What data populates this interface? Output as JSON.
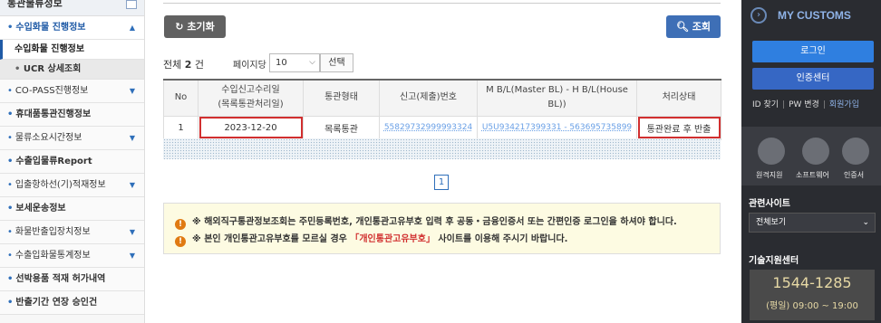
{
  "sidebar": {
    "top_title": "통관물류정보",
    "items": [
      {
        "label": "수입화물 진행정보",
        "active": true
      },
      {
        "label": "수입화물 진행정보",
        "sub": true,
        "current": true
      },
      {
        "label": "UCR 상세조회",
        "sub": true,
        "gray": true
      },
      {
        "label": "CO-PASS진행정보"
      },
      {
        "label": "휴대품통관진행정보"
      },
      {
        "label": "물류소요시간정보"
      },
      {
        "label": "수출입물류Report"
      },
      {
        "label": "입출항하선(기)적재정보"
      },
      {
        "label": "보세운송정보"
      },
      {
        "label": "화물반출입장치정보"
      },
      {
        "label": "수출입화물통계정보"
      },
      {
        "label": "선박용품 적재 허가내역"
      },
      {
        "label": "반출기간 연장 승인건"
      }
    ]
  },
  "toolbar": {
    "reset_label": "초기화",
    "search_label": "조회"
  },
  "list": {
    "total_prefix": "전체",
    "total_count": "2",
    "total_suffix": "건",
    "perpage_label": "페이지당",
    "perpage_value": "10",
    "select_label": "선택"
  },
  "table": {
    "headers": [
      "No",
      "수입신고수리일\n(목록통관처리일)",
      "통관형태",
      "신고(제출)번호",
      "M B/L(Master BL) - H B/L(House BL))",
      "처리상태"
    ],
    "rows": [
      {
        "no": "1",
        "date": "2023-12-20",
        "type": "목록통관",
        "number": "55829732999993324",
        "bl": "U5U934217399331 - 563695735899",
        "status": "통관완료 후 반출"
      }
    ]
  },
  "pager": {
    "current": "1"
  },
  "notice": {
    "line1": "※ 해외직구통관정보조회는 주민등록번호, 개인통관고유부호 입력 후 공동・금융인증서 또는 간편인증 로그인을 하셔야 합니다.",
    "line2_a": "※ 본인 개인통관고유부호를 모르실 경우 ",
    "line2_link": "「개인통관고유부호」",
    "line2_b": " 사이트를 이용해 주시기 바랍니다."
  },
  "right_panel": {
    "title": "MY CUSTOMS",
    "login": "로그인",
    "auth_center": "인증센터",
    "find_id": "ID 찾기",
    "change_pw": "PW 변경",
    "join": "회원가입",
    "icon_labels": [
      "원격지원",
      "소프트웨어",
      "인증서"
    ],
    "related_title": "관련사이트",
    "related_select": "전체보기",
    "support_title": "기술지원센터",
    "phone": "1544-1285",
    "hours": "(평일) 09:00 ~ 19:00"
  }
}
